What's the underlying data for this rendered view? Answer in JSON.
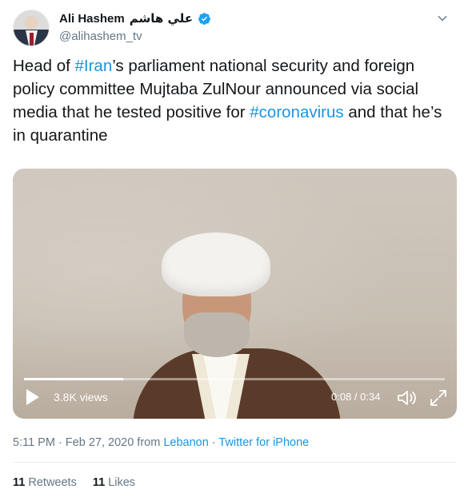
{
  "author": {
    "display_name": "Ali Hashem",
    "arabic_name": "علي هاشم",
    "handle": "@alihashem_tv",
    "verified_icon": "verified-badge-icon"
  },
  "tweet": {
    "t1": "Head of ",
    "tag_iran": "#Iran",
    "t2": "’s parliament national security and foreign policy committee Mujtaba ZulNour announced via social media that he tested positive for ",
    "tag_corona": "#coronavirus",
    "t3": " and that he’s in quarantine"
  },
  "video": {
    "views": "3.8K views",
    "time": "0:08 / 0:34",
    "progress_fraction": 0.235
  },
  "meta": {
    "time_date": "5:11 PM · Feb 27, 2020 from ",
    "location": "Lebanon",
    "separator": " · ",
    "source": "Twitter for iPhone"
  },
  "stats": {
    "retweets_count": "11",
    "retweets_label": "Retweets",
    "likes_count": "11",
    "likes_label": "Likes"
  },
  "colors": {
    "link": "#1b95e0",
    "muted": "#657786",
    "text": "#14171a"
  }
}
